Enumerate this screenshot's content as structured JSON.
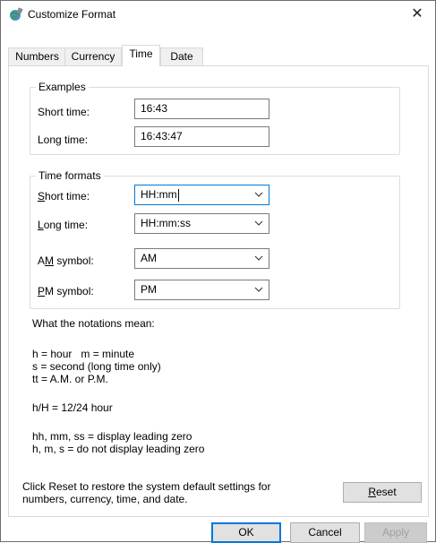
{
  "window": {
    "title": "Customize Format",
    "close_glyph": "✕"
  },
  "tabs": [
    {
      "label": "Numbers",
      "active": false
    },
    {
      "label": "Currency",
      "active": false
    },
    {
      "label": "Time",
      "active": true
    },
    {
      "label": "Date",
      "active": false
    }
  ],
  "examples": {
    "title": "Examples",
    "short_time_label": "Short time:",
    "short_time_value": "16:43",
    "long_time_label": "Long time:",
    "long_time_value": "16:43:47"
  },
  "time_formats": {
    "title": "Time formats",
    "short_time": {
      "label_mnemonic": "S",
      "label_rest": "hort time:",
      "value": "HH:mm"
    },
    "long_time": {
      "label_mnemonic": "L",
      "label_rest": "ong time:",
      "value": "HH:mm:ss"
    },
    "am_symbol": {
      "label_prefix": "A",
      "label_mnemonic": "M",
      "label_rest": " symbol:",
      "value": "AM"
    },
    "pm_symbol": {
      "label_mnemonic": "P",
      "label_rest": "M symbol:",
      "value": "PM"
    }
  },
  "notations": {
    "heading": "What the notations mean:",
    "line1": "h = hour   m = minute",
    "line2": "s = second (long time only)",
    "line3": "tt = A.M. or P.M.",
    "line4": "h/H = 12/24 hour",
    "line5": "hh, mm, ss = display leading zero",
    "line6": "h, m, s = do not display leading zero"
  },
  "reset": {
    "text_line1": "Click Reset to restore the system default settings for",
    "text_line2": "numbers, currency, time, and date.",
    "button_mnemonic": "R",
    "button_rest": "eset"
  },
  "footer": {
    "ok": "OK",
    "cancel": "Cancel",
    "apply": "Apply"
  },
  "colors": {
    "accent": "#0078d7",
    "border": "#7a7a7a"
  }
}
